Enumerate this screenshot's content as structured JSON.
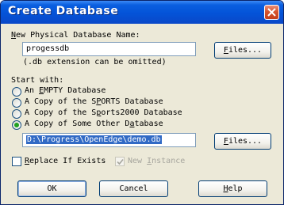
{
  "window": {
    "title": "Create Database"
  },
  "name_section": {
    "label": "New Physical Database Name:",
    "value": "progessdb",
    "files_button": "Files...",
    "hint": "(.db extension can be omitted)"
  },
  "start_with": {
    "label": "Start with:",
    "options": [
      {
        "label": "An EMPTY Database",
        "checked": false
      },
      {
        "label": "A Copy of the SPORTS Database",
        "checked": false
      },
      {
        "label": "A Copy of the Sports2000 Database",
        "checked": false
      },
      {
        "label": "A Copy of Some Other Database",
        "checked": true
      }
    ],
    "path_value": "D:\\Progress\\OpenEdge\\demo.db",
    "files_button": "Files..."
  },
  "replace_if_exists": {
    "label": "Replace If Exists",
    "checked": false
  },
  "new_instance": {
    "label": "New Instance",
    "checked": true,
    "disabled": true
  },
  "buttons": {
    "ok": "OK",
    "cancel": "Cancel",
    "help": "Help"
  }
}
